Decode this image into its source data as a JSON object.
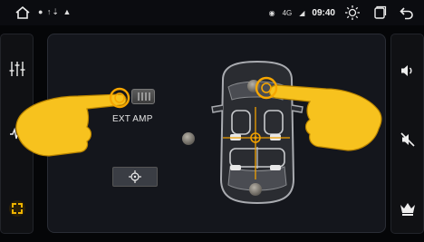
{
  "status_bar": {
    "notification_icons": "● ↑⇣ ▲",
    "network_label": "4G",
    "time": "09:40"
  },
  "left_sidebar": {
    "items": [
      {
        "icon": "equalizer-icon"
      },
      {
        "icon": "sound-field-icon"
      },
      {
        "icon": "speaker-position-icon",
        "active": true
      }
    ]
  },
  "right_sidebar": {
    "items": [
      {
        "icon": "volume-icon"
      },
      {
        "icon": "mute-icon"
      },
      {
        "icon": "crown-icon"
      }
    ]
  },
  "main": {
    "ext_amp_label": "EXT AMP",
    "center_button_icon": "crosshair-icon"
  },
  "colors": {
    "accent": "#f0b400",
    "hand": "#f7c21e",
    "listening_point": "#f7a600"
  }
}
